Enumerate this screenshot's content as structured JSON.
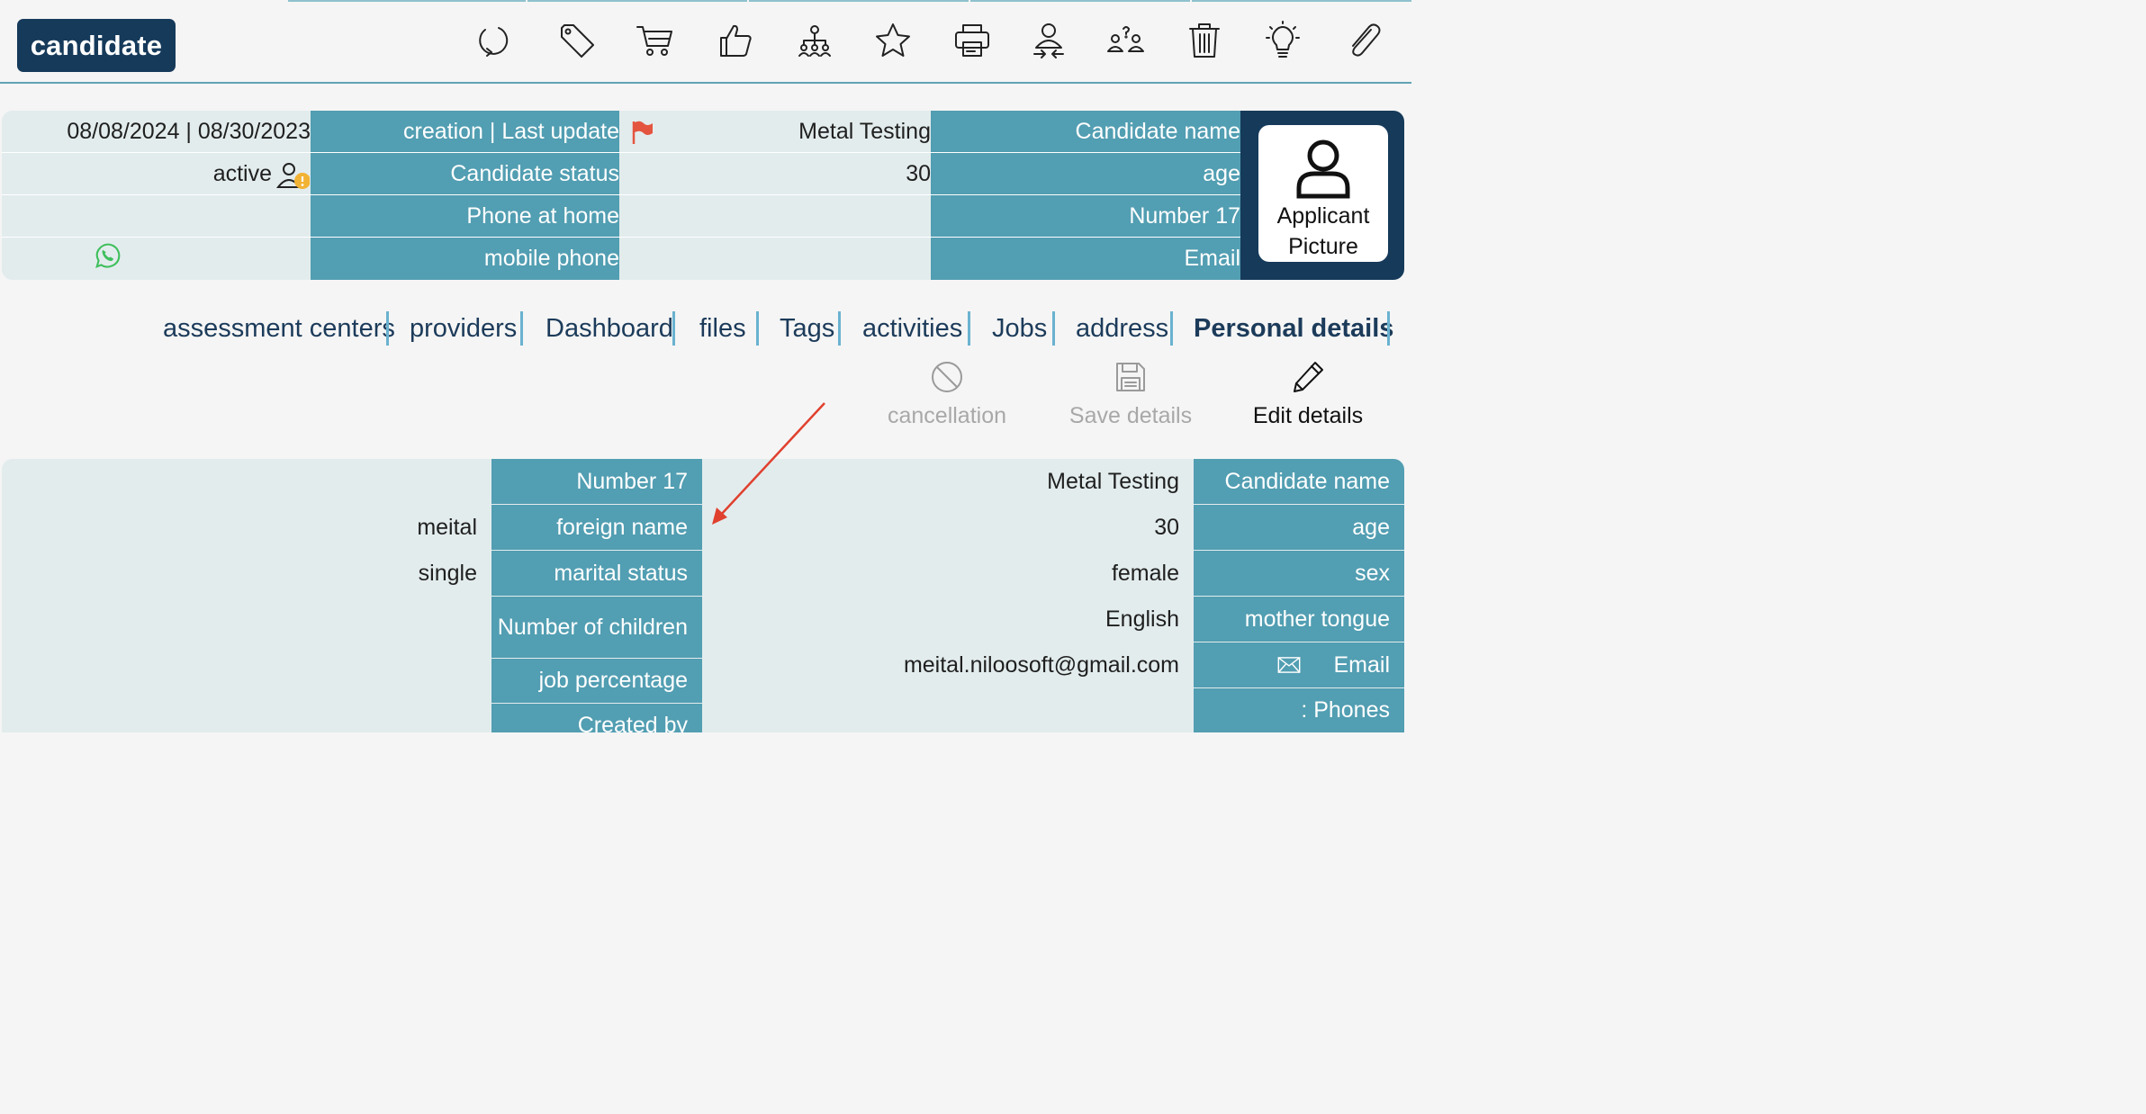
{
  "header": {
    "brand": "candidate",
    "toolbar": [
      {
        "name": "refresh-icon"
      },
      {
        "name": "tag-icon"
      },
      {
        "name": "cart-icon"
      },
      {
        "name": "thumbs-up-icon"
      },
      {
        "name": "org-chart-icon"
      },
      {
        "name": "star-icon"
      },
      {
        "name": "printer-icon"
      },
      {
        "name": "merge-user-icon"
      },
      {
        "name": "users-question-icon"
      },
      {
        "name": "trash-icon"
      },
      {
        "name": "lightbulb-icon"
      },
      {
        "name": "paperclip-icon"
      }
    ]
  },
  "summary": {
    "dates_value": "08/08/2024 | 08/30/2023",
    "dates_label": "creation | Last update",
    "name_value": "Metal Testing",
    "name_label": "Candidate name",
    "status_value": "active",
    "status_label": "Candidate status",
    "age_value": "30",
    "age_label": "age",
    "home_phone_value": "",
    "home_phone_label": "Phone at home",
    "id_value": "",
    "id_label": "Number 17",
    "mobile_value": "",
    "mobile_label": "mobile phone",
    "email_value": "",
    "email_label": "Email",
    "photo_label_line1": "Applicant",
    "photo_label_line2": "Picture",
    "colors": {
      "teal": "#529eb2",
      "navy": "#163a5a",
      "flag": "#e4553f",
      "whatsapp": "#3fbf5c",
      "badge": "#f2b233"
    }
  },
  "tabs": [
    {
      "label": "assessment centers"
    },
    {
      "label": "providers"
    },
    {
      "label": "Dashboard"
    },
    {
      "label": "files"
    },
    {
      "label": "Tags"
    },
    {
      "label": "activities"
    },
    {
      "label": "Jobs"
    },
    {
      "label": "address"
    },
    {
      "label": "Personal details",
      "active": true
    }
  ],
  "actions": {
    "cancel_label": "cancellation",
    "save_label": "Save details",
    "edit_label": "Edit details"
  },
  "details": {
    "left": [
      {
        "label": "Number 17",
        "value": ""
      },
      {
        "label": "foreign name",
        "value": "meital"
      },
      {
        "label": "marital status",
        "value": "single"
      },
      {
        "label": "Number of children",
        "value": ""
      },
      {
        "label": "job percentage",
        "value": ""
      },
      {
        "label": "Created by",
        "value": ""
      }
    ],
    "right": [
      {
        "label": "Candidate name",
        "value": "Metal Testing"
      },
      {
        "label": "age",
        "value": "30"
      },
      {
        "label": "sex",
        "value": "female"
      },
      {
        "label": "mother tongue",
        "value": "English"
      },
      {
        "label": "Email",
        "value": "meital.niloosoft@gmail.com"
      },
      {
        "label": ": Phones",
        "value": ""
      }
    ]
  }
}
